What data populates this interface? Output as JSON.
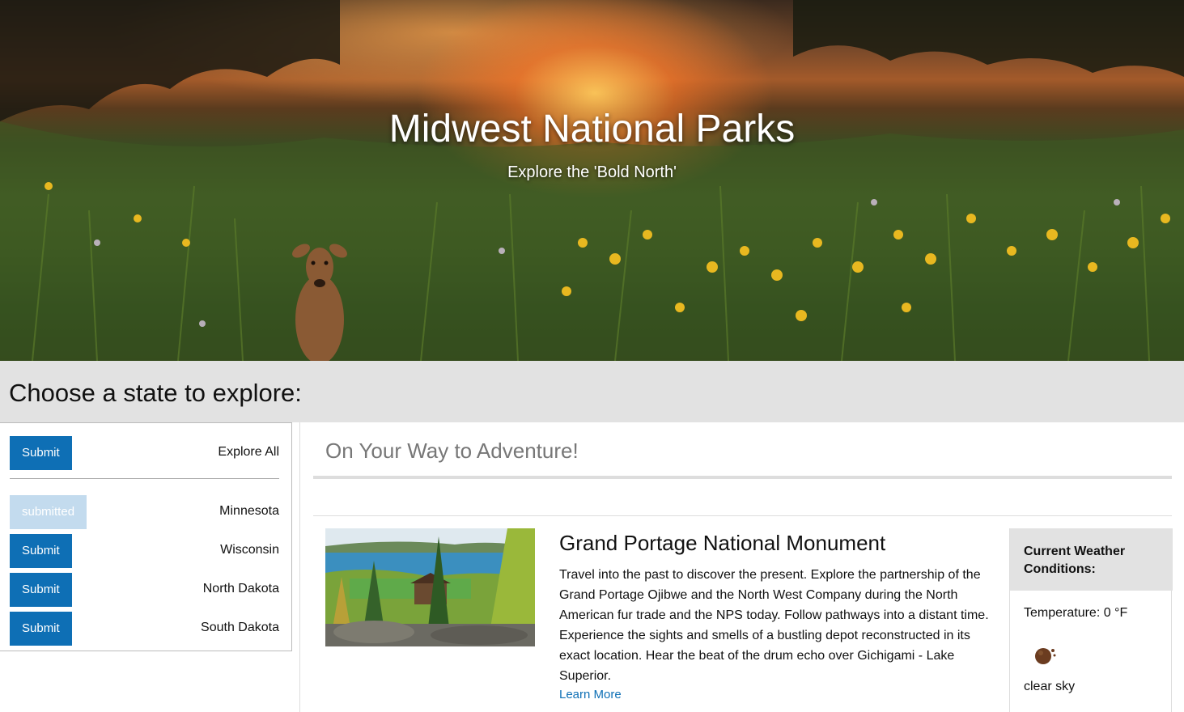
{
  "hero": {
    "title": "Midwest National Parks",
    "subtitle": "Explore the 'Bold North'"
  },
  "states_section": {
    "heading": "Choose a state to explore:"
  },
  "sidebar": {
    "explore_all": {
      "button_label": "Submit",
      "label": "Explore All"
    },
    "states": [
      {
        "button_label": "submitted",
        "label": "Minnesota",
        "state": "submitted"
      },
      {
        "button_label": "Submit",
        "label": "Wisconsin",
        "state": "default"
      },
      {
        "button_label": "Submit",
        "label": "North Dakota",
        "state": "default"
      },
      {
        "button_label": "Submit",
        "label": "South Dakota",
        "state": "default"
      }
    ]
  },
  "main": {
    "heading": "On Your Way to Adventure!",
    "park": {
      "title": "Grand Portage National Monument",
      "description": "Travel into the past to discover the present. Explore the partnership of the Grand Portage Ojibwe and the North West Company during the North American fur trade and the NPS today. Follow pathways into a distant time. Experience the sights and smells of a bustling depot reconstructed in its exact location. Hear the beat of the drum echo over Gichigami - Lake Superior.",
      "link_label": "Learn More"
    },
    "weather": {
      "heading": "Current Weather Conditions:",
      "temperature": "Temperature: 0 °F",
      "icon": "clear-sky-icon",
      "description": "clear sky"
    }
  },
  "colors": {
    "primary_button": "#0e6fb5",
    "submitted_button": "#c3dbee",
    "section_bg": "#e2e2e2",
    "link": "#0e6fb5"
  }
}
